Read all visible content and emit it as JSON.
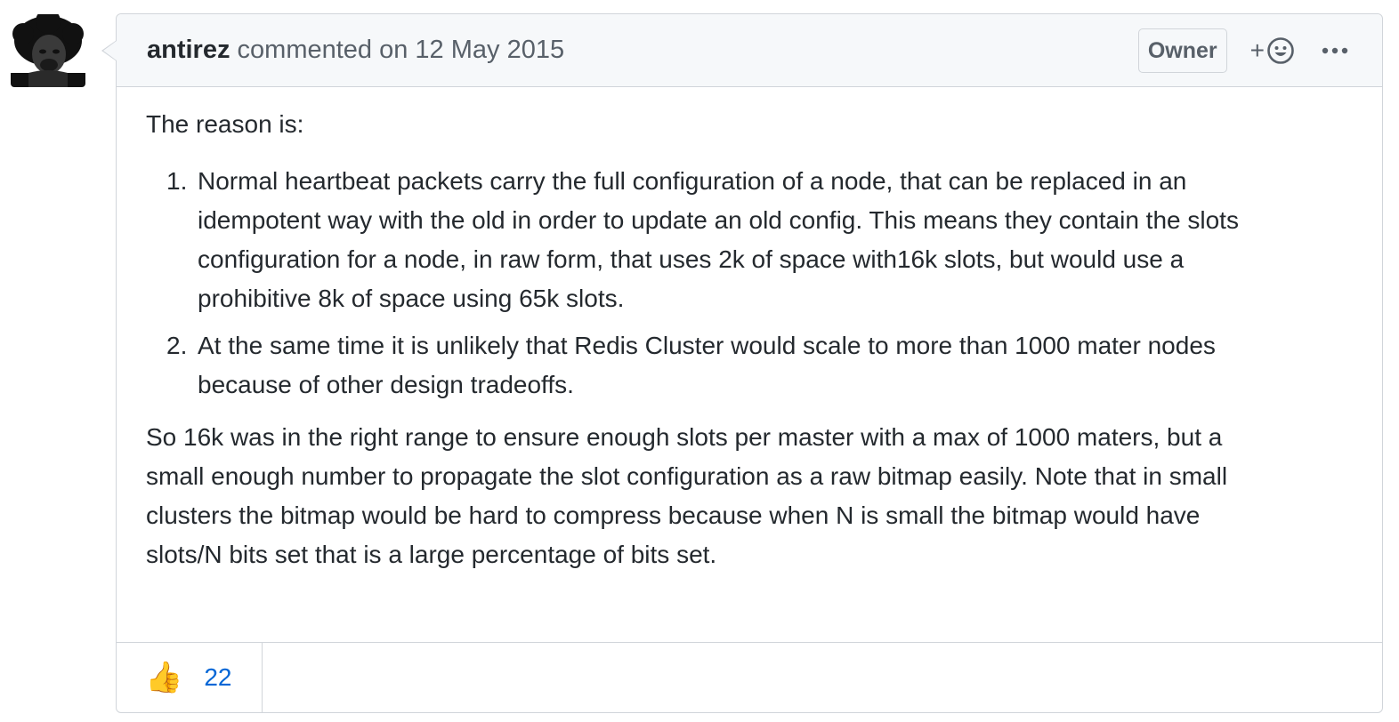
{
  "comment": {
    "author": "antirez",
    "action_text": "commented on 12 May 2015",
    "role_badge": "Owner",
    "add_reaction_plus": "+",
    "body": {
      "intro": "The reason is:",
      "list": [
        {
          "number": "1.",
          "lines": [
            "Normal heartbeat packets carry the full configuration of a node, that can be replaced in an",
            "idempotent way with the old in order to update an old config. This means they contain the slots",
            "configuration for a node, in raw form, that uses 2k of space with16k slots, but would use a",
            "prohibitive 8k of space using 65k slots."
          ]
        },
        {
          "number": "2.",
          "lines": [
            "At the same time it is unlikely that Redis Cluster would scale to more than 1000 mater nodes",
            "because of other design tradeoffs."
          ]
        }
      ],
      "outro_lines": [
        "So 16k was in the right range to ensure enough slots per master with a max of 1000 maters, but a",
        "small enough number to propagate the slot configuration as a raw bitmap easily. Note that in small",
        "clusters the bitmap would be hard to compress because when N is small the bitmap would have",
        "slots/N bits set that is a large percentage of bits set."
      ]
    },
    "reactions": [
      {
        "icon": "thumbs-up-icon",
        "emoji": "👍",
        "count": "22"
      }
    ]
  },
  "colors": {
    "header_bg": "#f6f8fa",
    "border": "#d1d5da",
    "text": "#24292e",
    "muted": "#586069",
    "link": "#0366d6"
  }
}
